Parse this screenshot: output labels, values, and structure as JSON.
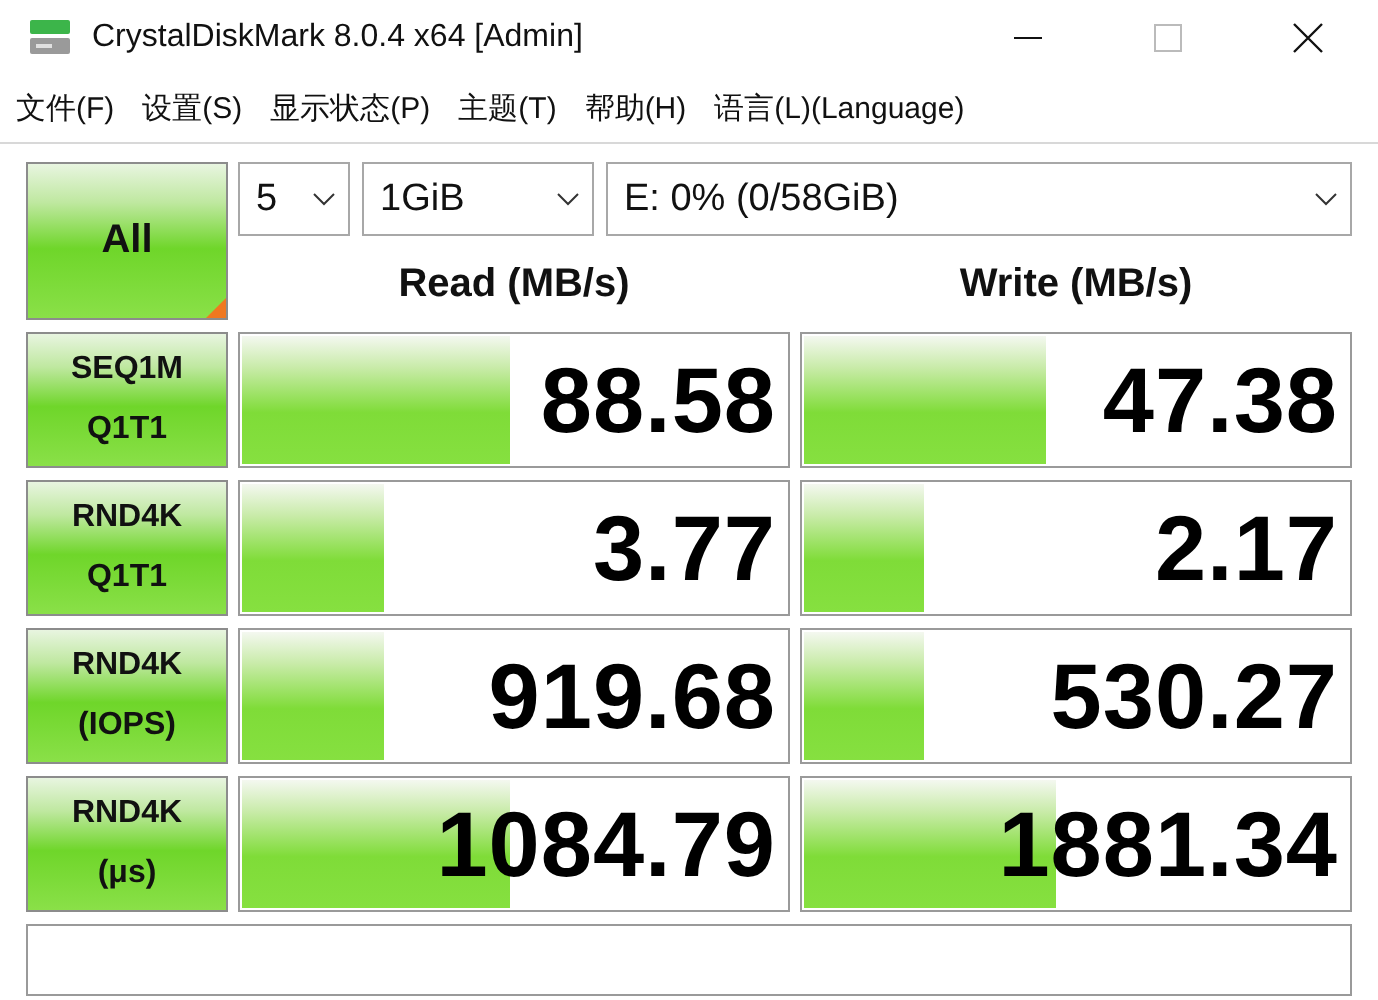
{
  "window": {
    "title": "CrystalDiskMark 8.0.4 x64 [Admin]"
  },
  "menu": [
    "文件(F)",
    "设置(S)",
    "显示状态(P)",
    "主题(T)",
    "帮助(H)",
    "语言(L)(Language)"
  ],
  "all_button": {
    "label": "All"
  },
  "selects": [
    {
      "value": "5"
    },
    {
      "value": "1GiB"
    },
    {
      "value": "E: 0% (0/58GiB)"
    }
  ],
  "headers": {
    "read": "Read (MB/s)",
    "write": "Write (MB/s)"
  },
  "tests": [
    {
      "label_lines": [
        "SEQ1M",
        "Q1T1"
      ],
      "read": {
        "value": "88.58",
        "level": 0.49
      },
      "write": {
        "value": "47.38",
        "level": 0.44
      }
    },
    {
      "label_lines": [
        "RND4K",
        "Q1T1"
      ],
      "read": {
        "value": "3.77",
        "level": 0.26
      },
      "write": {
        "value": "2.17",
        "level": 0.22
      }
    },
    {
      "label_lines": [
        "RND4K",
        "(IOPS)"
      ],
      "read": {
        "value": "919.68",
        "level": 0.26
      },
      "write": {
        "value": "530.27",
        "level": 0.22
      }
    },
    {
      "label_lines": [
        "RND4K",
        "(μs)"
      ],
      "read": {
        "value": "1084.79",
        "level": 0.49
      },
      "write": {
        "value": "1881.34",
        "level": 0.46
      }
    }
  ]
}
